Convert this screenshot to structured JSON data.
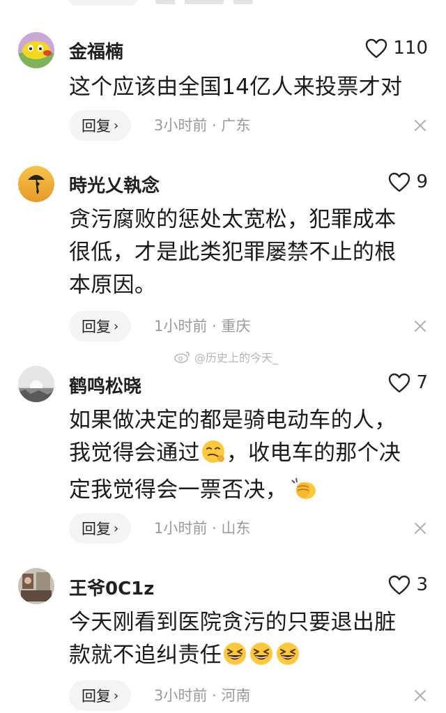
{
  "comments": [
    {
      "username": "金福楠",
      "likes": "110",
      "lines": [
        "这个应该由全国14亿人来投票才对"
      ],
      "reply_label": "回复",
      "meta": "3小时前 · 广东"
    },
    {
      "username": "時光乂執念",
      "likes": "9",
      "lines": [
        "贪污腐败的惩处太宽松，犯罪成本",
        "很低，才是此类犯罪屡禁不止的根",
        "本原因。"
      ],
      "reply_label": "回复",
      "meta": "1小时前 · 重庆"
    },
    {
      "username": "鹤鸣松晓",
      "likes": "7",
      "lines": [
        "如果做决定的都是骑电动车的人，",
        "我觉得会通过",
        "，收电车的那个决",
        "定我觉得会一票否决，"
      ],
      "reply_label": "回复",
      "meta": "1小时前 · 山东"
    },
    {
      "username": "王爷0C1z",
      "likes": "3",
      "lines": [
        "今天刚看到医院贪污的只要退出脏",
        "款就不追纠责任"
      ],
      "reply_label": "回复",
      "meta": "3小时前 · 河南"
    }
  ],
  "watermark": "@历史上的今天_",
  "icons": {
    "like": "heart-outline-icon",
    "reply_chevron": "chevron-right-icon",
    "dismiss": "close-icon",
    "watermark_logo": "weibo-logo-icon",
    "emojis": [
      "smug-face-emoji",
      "clapping-hands-emoji",
      "grinning-squint-emoji"
    ]
  },
  "colors": {
    "meta": "#9a9a9a",
    "reply_bg": "#f4f4f4",
    "emoji_yellow": "#ffc83d"
  }
}
